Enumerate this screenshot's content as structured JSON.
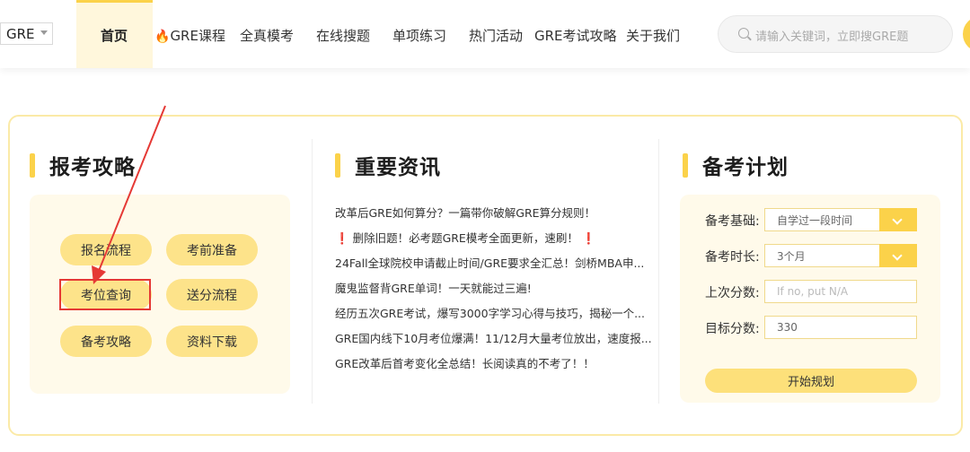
{
  "header": {
    "exam_select": "GRE",
    "nav": [
      "首页",
      "GRE课程",
      "全真模考",
      "在线搜题",
      "单项练习",
      "热门活动",
      "GRE考试攻略",
      "关于我们"
    ],
    "search_placeholder": "请输入关键词，立即搜GRE题"
  },
  "sections": {
    "guide": {
      "title": "报考攻略",
      "buttons": [
        "报名流程",
        "考前准备",
        "考位查询",
        "送分流程",
        "备考攻略",
        "资料下载"
      ]
    },
    "news": {
      "title": "重要资讯",
      "items": [
        "改革后GRE如何算分？一篇带你破解GRE算分规则！",
        "删除旧题！必考题GRE模考全面更新，速刷！",
        "24Fall全球院校申请截止时间/GRE要求全汇总！剑桥MBA申...",
        "魔鬼监督背GRE单词！一天就能过三遍!",
        "经历五次GRE考试，爆写3000字学习心得与技巧，揭秘一个...",
        "GRE国内线下10月考位爆满！11/12月大量考位放出，速度报...",
        "GRE改革后首考变化全总结！长阅读真的不考了！！"
      ],
      "marker": "❗"
    },
    "plan": {
      "title": "备考计划",
      "labels": [
        "备考基础:",
        "备考时长:",
        "上次分数:",
        "目标分数:"
      ],
      "base_value": "自学过一段时间",
      "duration_value": "3个月",
      "last_score_placeholder": "If no, put N/A",
      "target_value": "330",
      "start_label": "开始规划"
    }
  },
  "colors": {
    "accent": "#fbd24a",
    "pill": "#fde38a",
    "highlight": "#e53935"
  }
}
